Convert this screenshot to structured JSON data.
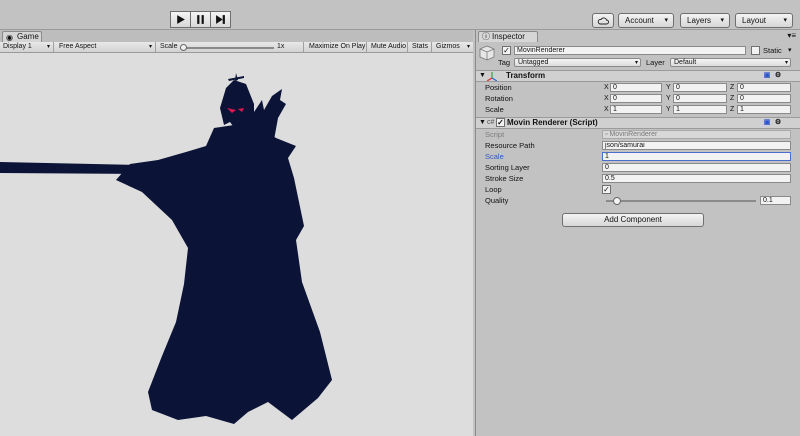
{
  "toolbar": {
    "play_icon": "play-icon",
    "pause_icon": "pause-icon",
    "step_icon": "step-icon",
    "cloud_icon": "cloud-icon",
    "account_label": "Account",
    "layers_label": "Layers",
    "layout_label": "Layout"
  },
  "game": {
    "tab_label": "Game",
    "display": "Display 1",
    "aspect": "Free Aspect",
    "scale_label": "Scale",
    "scale_value": "1x",
    "maximize_label": "Maximize On Play",
    "mute_label": "Mute Audio",
    "stats_label": "Stats",
    "gizmos_label": "Gizmos",
    "silhouette_color": "#0b1437",
    "eye_color": "#e0184f",
    "background_color": "#dddddd"
  },
  "inspector": {
    "tab_label": "Inspector",
    "object_name": "MovinRenderer",
    "active": true,
    "static_label": "Static",
    "static": false,
    "tag_label": "Tag",
    "tag_value": "Untagged",
    "layer_label": "Layer",
    "layer_value": "Default",
    "transform": {
      "title": "Transform",
      "rows": [
        {
          "label": "Position",
          "x": "0",
          "y": "0",
          "z": "0"
        },
        {
          "label": "Rotation",
          "x": "0",
          "y": "0",
          "z": "0"
        },
        {
          "label": "Scale",
          "x": "1",
          "y": "1",
          "z": "1"
        }
      ]
    },
    "axes": {
      "x": "X",
      "y": "Y",
      "z": "Z"
    },
    "movin": {
      "title": "Movin Renderer (Script)",
      "enabled": true,
      "script_label": "Script",
      "script_value": "MovinRenderer",
      "resource_path_label": "Resource Path",
      "resource_path_value": "json/samurai",
      "scale_label": "Scale",
      "scale_value": "1",
      "sorting_layer_label": "Sorting Layer",
      "sorting_layer_value": "0",
      "stroke_size_label": "Stroke Size",
      "stroke_size_value": "0.5",
      "loop_label": "Loop",
      "loop_value": true,
      "quality_label": "Quality",
      "quality_value": "0.1",
      "quality_fraction": 0.1
    },
    "add_component_label": "Add Component"
  }
}
